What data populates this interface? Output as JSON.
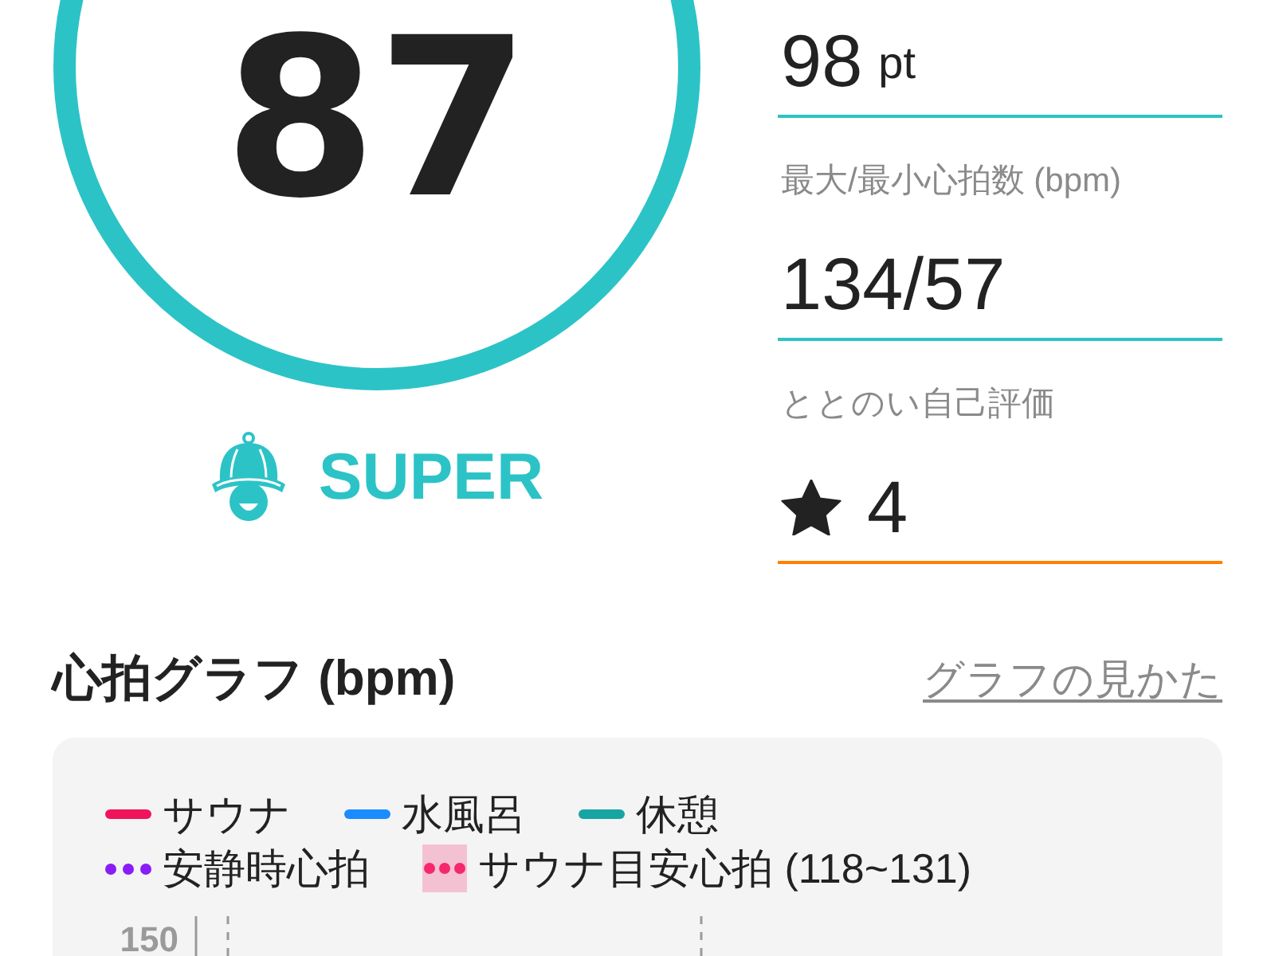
{
  "score": {
    "value": "87"
  },
  "rank": {
    "label": "SUPER"
  },
  "stats": [
    {
      "kind": "value",
      "value": "98",
      "unit": "pt",
      "color": "#2cc3c7"
    },
    {
      "kind": "value",
      "label": "最大/最小心拍数 (bpm)",
      "value": "134/57",
      "color": "#2cc3c7"
    },
    {
      "kind": "rating",
      "label": "ととのい自己評価",
      "value": "4",
      "color": "#ff8000"
    }
  ],
  "heart_rate_graph": {
    "title": "心拍グラフ (bpm)",
    "help_link": "グラフの見かた",
    "legend": [
      {
        "items": [
          {
            "label": "サウナ",
            "kind": "line",
            "color": "#f0145a"
          },
          {
            "label": "水風呂",
            "kind": "line",
            "color": "#1a8cff"
          },
          {
            "label": "休憩",
            "kind": "line",
            "color": "#17a5a3"
          }
        ]
      },
      {
        "items": [
          {
            "label": "安静時心拍",
            "kind": "dotted",
            "color": "#8a1cf5"
          },
          {
            "label": "サウナ目安心拍 (118~131)",
            "kind": "band",
            "color": "#f5286e"
          }
        ]
      }
    ],
    "y_tick_labels": [
      "150"
    ]
  }
}
